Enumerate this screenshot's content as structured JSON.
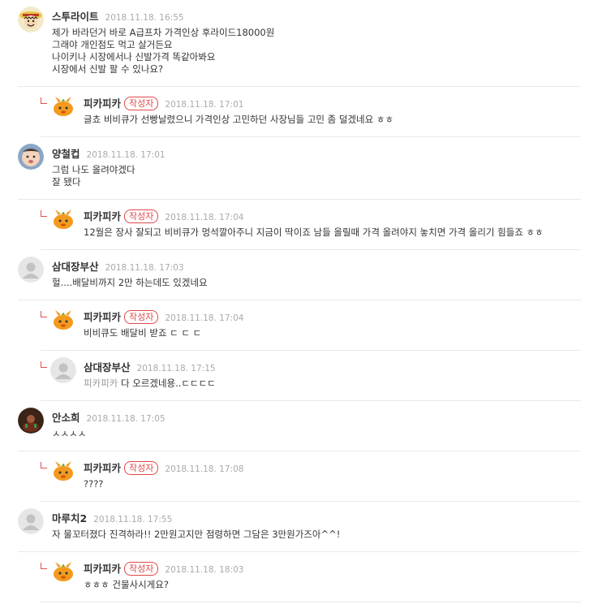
{
  "comments": [
    {
      "author": "스투라이트",
      "time": "2018.11.18. 16:55",
      "text": "제가 바라던거 바로 A급프차 가격인상 후라이드18000원\n그래야 개인점도 먹고 살거든요\n나이키나 시장에서나 신발가격 똑같아봐요\n시장에서 신발 팔 수 있나요?",
      "avatar_icon": "luffy-avatar-icon",
      "reply": false
    },
    {
      "author": "피카피카",
      "badge": "작성자",
      "time": "2018.11.18. 17:01",
      "text": "글쵸 비비큐가 선빵날렸으니 가격인상 고민하던 사장님들 고민 좀 덜겠네요 ㅎㅎ",
      "avatar_icon": "orange-mascot-icon",
      "reply": true
    },
    {
      "author": "양철컵",
      "time": "2018.11.18. 17:01",
      "text": "그럼 나도 올려야겠다\n잘 됐다",
      "avatar_icon": "baby-photo-avatar-icon",
      "reply": false
    },
    {
      "author": "피카피카",
      "badge": "작성자",
      "time": "2018.11.18. 17:04",
      "text": "12월은 장사 잘되고 비비큐가 멍석깔아주니 지금이 딱이죠 남들 올릴때 가격 올려야지 놓치면 가격 올리기 힘들죠 ㅎㅎ",
      "avatar_icon": "orange-mascot-icon",
      "reply": true
    },
    {
      "author": "삼대장부산",
      "time": "2018.11.18. 17:03",
      "text": "헐....배달비까지 2만 하는데도 있겠네요",
      "avatar_icon": "default-user-icon",
      "reply": false
    },
    {
      "author": "피카피카",
      "badge": "작성자",
      "time": "2018.11.18. 17:04",
      "text": "비비큐도 배달비 받죠 ㄷ ㄷ ㄷ",
      "avatar_icon": "orange-mascot-icon",
      "reply": true
    },
    {
      "author": "삼대장부산",
      "time": "2018.11.18. 17:15",
      "mention": "피카피카",
      "text": "다 오르겠네용..ㄷㄷㄷㄷ",
      "avatar_icon": "default-user-icon",
      "reply": true
    },
    {
      "author": "안소희",
      "time": "2018.11.18. 17:05",
      "text": "ㅅㅅㅅㅅ",
      "avatar_icon": "dark-photo-avatar-icon",
      "reply": false
    },
    {
      "author": "피카피카",
      "badge": "작성자",
      "time": "2018.11.18. 17:08",
      "text": "????",
      "avatar_icon": "orange-mascot-icon",
      "reply": true
    },
    {
      "author": "마루치2",
      "time": "2018.11.18. 17:55",
      "text": "자 물꼬터졌다 진격하라!! 2만원고지만 점령하면 그담은 3만원가즈아^^!",
      "avatar_icon": "default-user-icon",
      "reply": false
    },
    {
      "author": "피카피카",
      "badge": "작성자",
      "time": "2018.11.18. 18:03",
      "text": "ㅎㅎㅎ 건물사시게요?",
      "avatar_icon": "orange-mascot-icon",
      "reply": true
    }
  ],
  "colors": {
    "badge": "#e04848",
    "reply_arrow": "#e05050",
    "time": "#aaaaaa",
    "divider": "#e9e9e9"
  }
}
